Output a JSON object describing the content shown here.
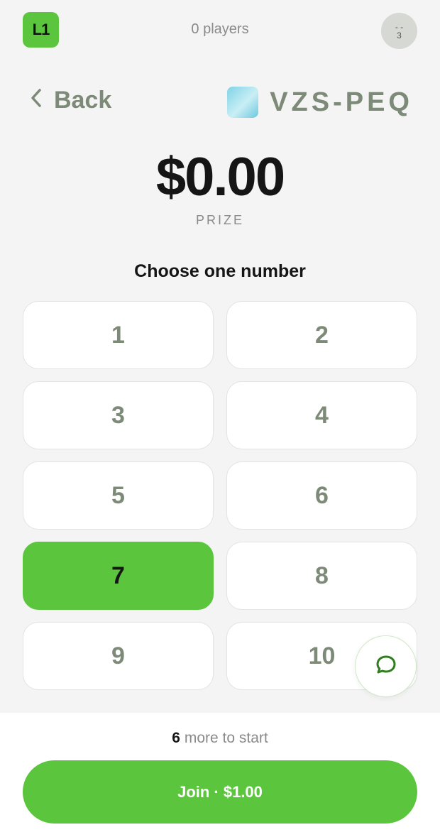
{
  "header": {
    "logo_text": "L1",
    "players_text": "0 players",
    "avatar_text": "- -\n3"
  },
  "nav": {
    "back_label": "Back",
    "game_code": "VZS-PEQ"
  },
  "prize": {
    "amount": "$0.00",
    "label": "PRIZE"
  },
  "picker": {
    "heading": "Choose one number",
    "numbers": [
      "1",
      "2",
      "3",
      "4",
      "5",
      "6",
      "7",
      "8",
      "9",
      "10"
    ],
    "selected": "7"
  },
  "footer": {
    "remaining_count": "6",
    "remaining_text": "more to start",
    "join_label": "Join · $1.00"
  },
  "colors": {
    "accent": "#5bc63d",
    "muted_text": "#7d8a78",
    "background": "#f4f4f4"
  },
  "icons": {
    "back": "chevron-left-icon",
    "chat": "chat-bubble-icon"
  }
}
